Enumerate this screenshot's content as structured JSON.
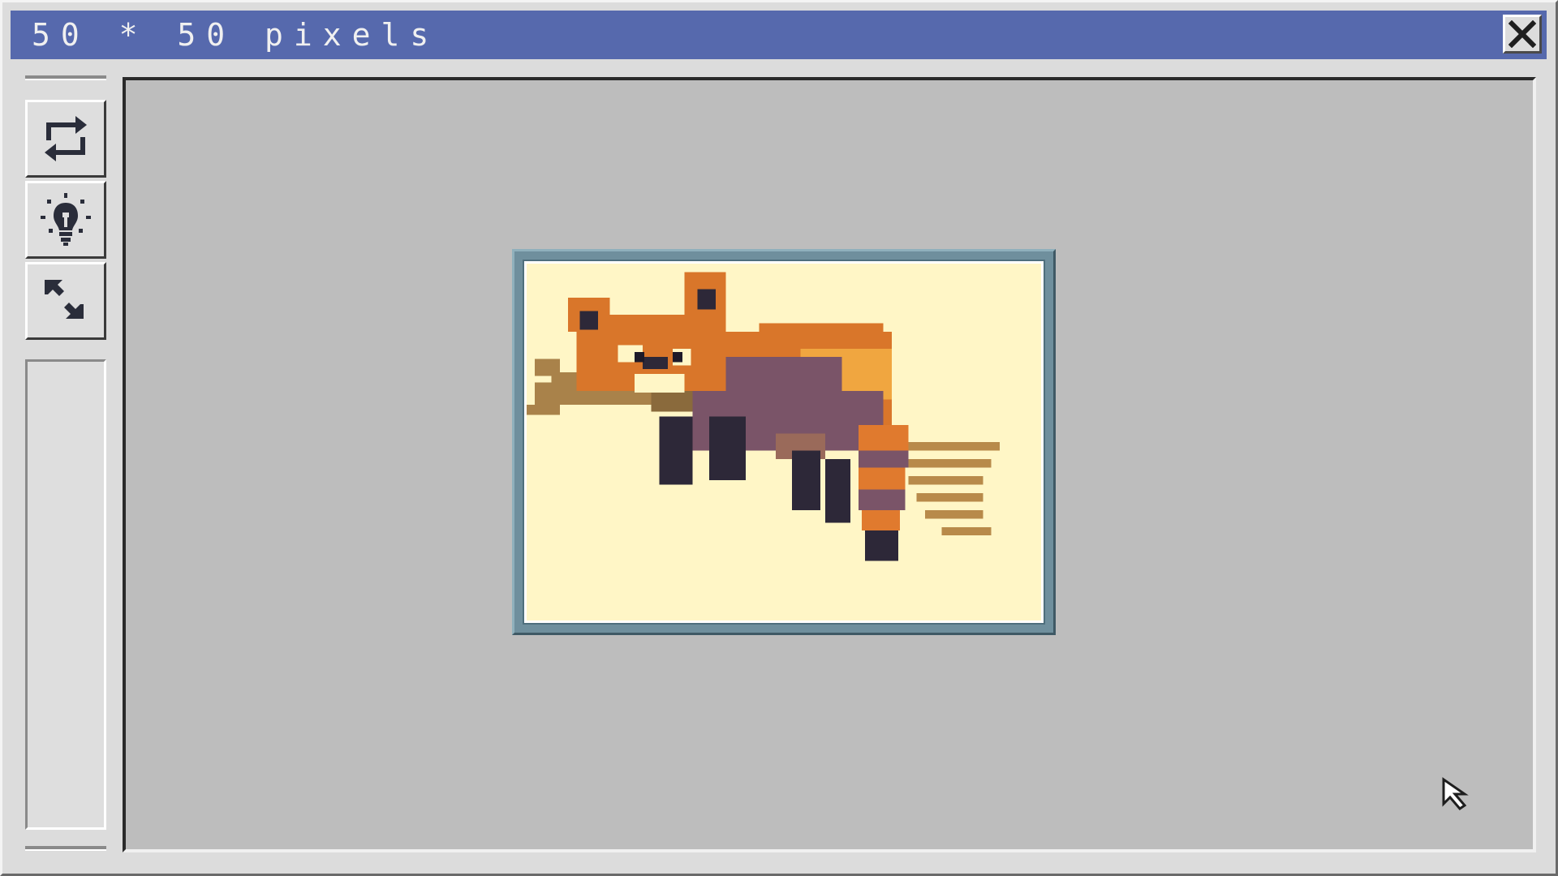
{
  "window": {
    "title": "50 * 50 pixels",
    "close_icon": "close-x-icon"
  },
  "toolbar": {
    "buttons": [
      {
        "name": "rotate-button",
        "icon": "rotate-icon"
      },
      {
        "name": "hint-button",
        "icon": "lightbulb-icon"
      },
      {
        "name": "resize-button",
        "icon": "shrink-arrows-icon"
      }
    ]
  },
  "canvas": {
    "artwork": "red-panda-pixel-art"
  },
  "colors": {
    "titlebar": "#5669ad",
    "canvas_bg": "#bdbdbd",
    "artwork_bg": "#fff6c6",
    "frame": "#6f8f9d"
  }
}
